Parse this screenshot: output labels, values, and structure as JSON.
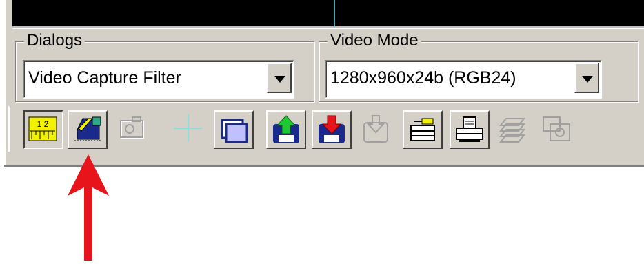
{
  "dialogs": {
    "legend": "Dialogs",
    "selected": "Video Capture Filter"
  },
  "video_mode": {
    "legend": "Video Mode",
    "selected": "1280x960x24b (RGB24)"
  },
  "ruler_label": "1 2",
  "toolbar": {
    "buttons": [
      {
        "icon": "ruler-icon",
        "state": "pressed"
      },
      {
        "icon": "capture-settings-icon",
        "state": "raised"
      },
      {
        "icon": "camera-icon",
        "state": "disabled"
      },
      {
        "icon": "crosshair-icon",
        "state": "disabled"
      },
      {
        "icon": "window-icon",
        "state": "raised"
      },
      {
        "icon": "upload-green-arrow-icon",
        "state": "raised"
      },
      {
        "icon": "download-red-arrow-icon",
        "state": "raised"
      },
      {
        "icon": "save-disabled-icon",
        "state": "disabled"
      },
      {
        "icon": "hardware-icon",
        "state": "raised"
      },
      {
        "icon": "print-icon",
        "state": "raised"
      },
      {
        "icon": "layers-icon",
        "state": "disabled"
      },
      {
        "icon": "copy-camera-icon",
        "state": "disabled"
      }
    ]
  },
  "colors": {
    "panel": "#d4d0c8",
    "arrow": "#e8141c",
    "ruler_yellow": "#f2f200"
  }
}
